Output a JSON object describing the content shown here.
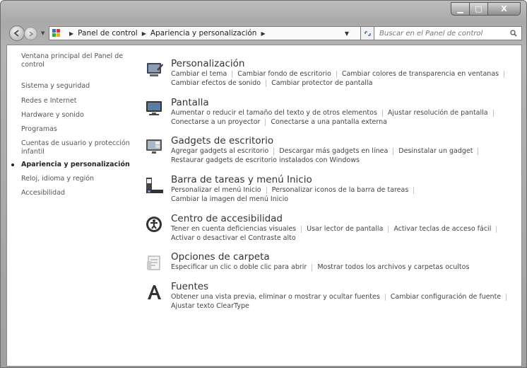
{
  "window": {
    "controls": {
      "minimize": "▁",
      "maximize": "□",
      "close": "X"
    }
  },
  "navigation": {
    "breadcrumb": [
      "Panel de control",
      "Apariencia y personalización"
    ],
    "search_placeholder": "Buscar en el Panel de control"
  },
  "sidebar": {
    "items": [
      {
        "label": "Ventana principal del Panel de control",
        "active": false
      },
      {
        "label": "Sistema y seguridad",
        "active": false
      },
      {
        "label": "Redes e Internet",
        "active": false
      },
      {
        "label": "Hardware y sonido",
        "active": false
      },
      {
        "label": "Programas",
        "active": false
      },
      {
        "label": "Cuentas de usuario y protección infantil",
        "active": false
      },
      {
        "label": "Apariencia y personalización",
        "active": true
      },
      {
        "label": "Reloj, idioma y región",
        "active": false
      },
      {
        "label": "Accesibilidad",
        "active": false
      }
    ]
  },
  "categories": [
    {
      "title": "Personalización",
      "icon": "personalization-icon",
      "links": [
        [
          "Cambiar el tema",
          "Cambiar fondo de escritorio",
          "Cambiar colores de transparencia en ventanas"
        ],
        [
          "Cambiar efectos de sonido",
          "Cambiar protector de pantalla"
        ]
      ]
    },
    {
      "title": "Pantalla",
      "icon": "display-icon",
      "links": [
        [
          "Aumentar o reducir el tamaño del texto y de otros elementos",
          "Ajustar resolución de pantalla"
        ],
        [
          "Conectarse a un proyector",
          "Conectarse a una pantalla externa"
        ]
      ]
    },
    {
      "title": "Gadgets de escritorio",
      "icon": "gadgets-icon",
      "links": [
        [
          "Agregar gadgets al escritorio",
          "Descargar más gadgets en línea",
          "Desinstalar un gadget"
        ],
        [
          "Restaurar gadgets de escritorio instalados con Windows"
        ]
      ]
    },
    {
      "title": "Barra de tareas y menú Inicio",
      "icon": "taskbar-icon",
      "links": [
        [
          "Personalizar el menú Inicio",
          "Personalizar iconos de la barra de tareas"
        ],
        [
          "Cambiar la imagen del menú Inicio"
        ]
      ]
    },
    {
      "title": "Centro de accesibilidad",
      "icon": "accessibility-icon",
      "links": [
        [
          "Tener en cuenta deficiencias visuales",
          "Usar lector de pantalla",
          "Activar teclas de acceso fácil"
        ],
        [
          "Activar o desactivar el Contraste alto"
        ]
      ]
    },
    {
      "title": "Opciones de carpeta",
      "icon": "folder-options-icon",
      "links": [
        [
          "Especificar un clic o doble clic para abrir",
          "Mostrar todos los archivos y carpetas ocultos"
        ]
      ]
    },
    {
      "title": "Fuentes",
      "icon": "fonts-icon",
      "links": [
        [
          "Obtener una vista previa, eliminar o mostrar y ocultar fuentes",
          "Cambiar configuración de fuente"
        ],
        [
          "Ajustar texto ClearType"
        ]
      ]
    }
  ]
}
